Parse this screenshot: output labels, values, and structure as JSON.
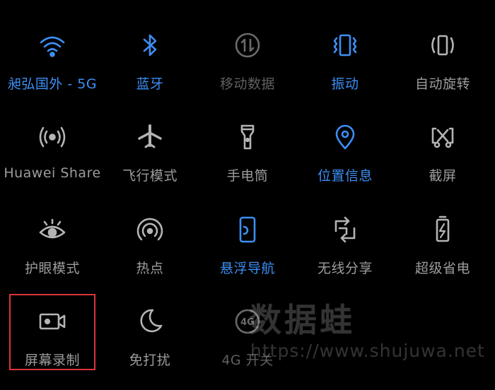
{
  "colors": {
    "active": "#3d8ff5",
    "inactive": "#b4b4b4",
    "disabled": "#6a6a6a",
    "highlight": "#d9343b",
    "background": "#000000"
  },
  "tiles": [
    {
      "label": "昶弘国外 - 5G",
      "icon": "wifi-icon",
      "state": "on"
    },
    {
      "label": "蓝牙",
      "icon": "bluetooth-icon",
      "state": "on"
    },
    {
      "label": "移动数据",
      "icon": "mobile-data-icon",
      "state": "dis"
    },
    {
      "label": "振动",
      "icon": "vibrate-icon",
      "state": "on"
    },
    {
      "label": "自动旋转",
      "icon": "auto-rotate-icon",
      "state": "off"
    },
    {
      "label": "Huawei Share",
      "icon": "huawei-share-icon",
      "state": "off"
    },
    {
      "label": "飞行模式",
      "icon": "airplane-icon",
      "state": "off"
    },
    {
      "label": "手电筒",
      "icon": "flashlight-icon",
      "state": "off"
    },
    {
      "label": "位置信息",
      "icon": "location-icon",
      "state": "on"
    },
    {
      "label": "截屏",
      "icon": "screenshot-icon",
      "state": "off"
    },
    {
      "label": "护眼模式",
      "icon": "eye-comfort-icon",
      "state": "off"
    },
    {
      "label": "热点",
      "icon": "hotspot-icon",
      "state": "off"
    },
    {
      "label": "悬浮导航",
      "icon": "floating-nav-icon",
      "state": "on"
    },
    {
      "label": "无线分享",
      "icon": "wireless-share-icon",
      "state": "off"
    },
    {
      "label": "超级省电",
      "icon": "power-saving-icon",
      "state": "off"
    },
    {
      "label": "屏幕录制",
      "icon": "screen-record-icon",
      "state": "off"
    },
    {
      "label": "免打扰",
      "icon": "do-not-disturb-icon",
      "state": "off"
    },
    {
      "label": "4G 开关",
      "icon": "4g-icon",
      "state": "dis"
    }
  ],
  "watermark": {
    "text": "数据蛙",
    "url": "https://www.shujuwa.net"
  }
}
